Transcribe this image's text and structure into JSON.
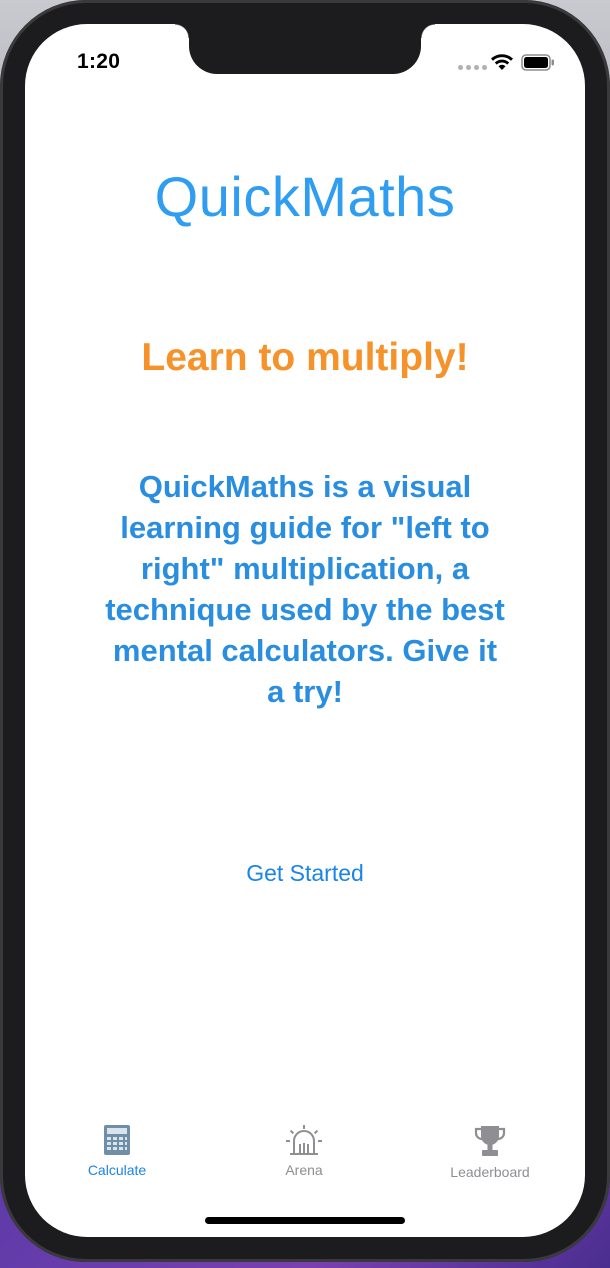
{
  "status_bar": {
    "time": "1:20"
  },
  "app": {
    "title": "QuickMaths",
    "subtitle": "Learn to multiply!",
    "description": "QuickMaths is a visual learning guide for \"left to right\" multiplication, a technique used by the best mental calculators. Give it a try!",
    "cta_label": "Get Started"
  },
  "tab_bar": {
    "items": [
      {
        "label": "Calculate",
        "icon": "calculator-icon",
        "selected": true
      },
      {
        "label": "Arena",
        "icon": "arena-icon",
        "selected": false
      },
      {
        "label": "Leaderboard",
        "icon": "trophy-icon",
        "selected": false
      }
    ]
  },
  "colors": {
    "title": "#2f9df0",
    "subtitle": "#f5922a",
    "description": "#2a8ee0",
    "link": "#1a84e8",
    "tab_active": "#1a84e8",
    "tab_inactive": "#8e8e93"
  }
}
